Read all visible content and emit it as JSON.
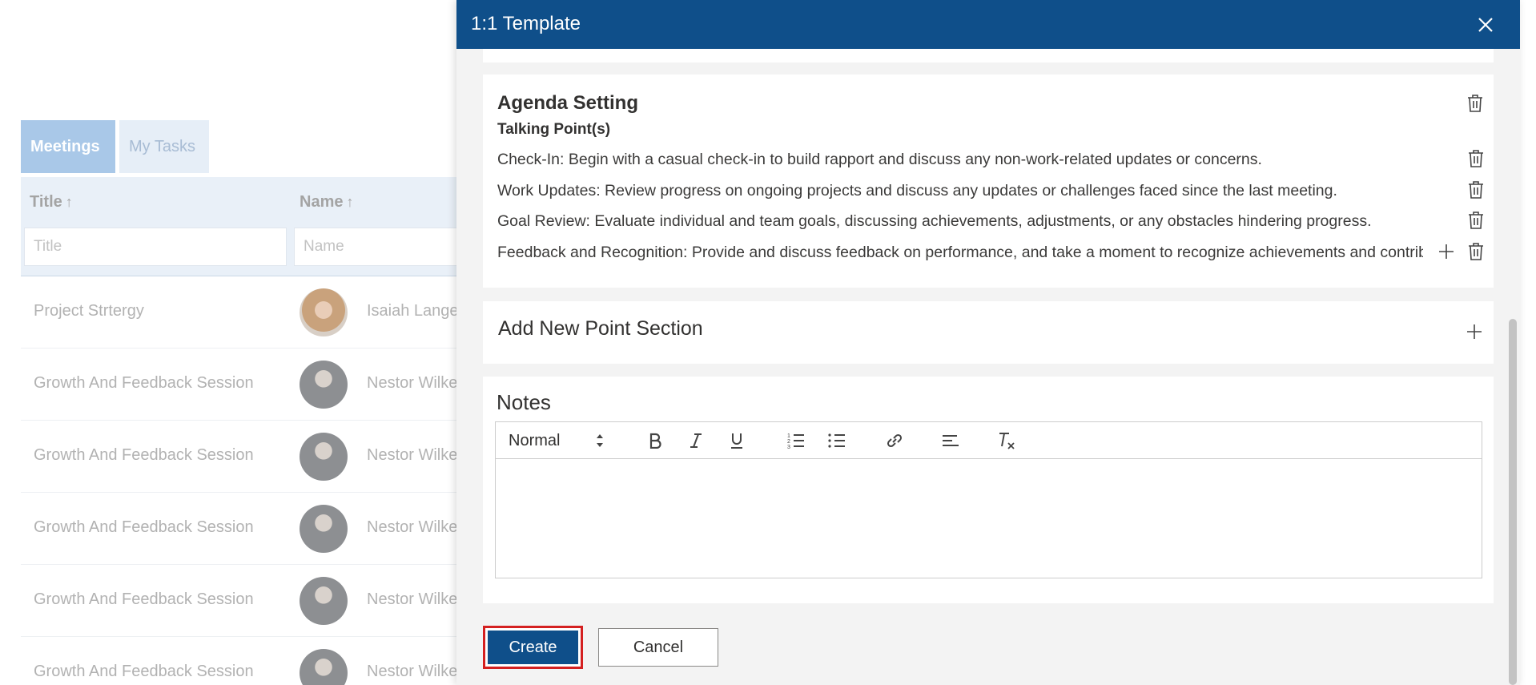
{
  "background": {
    "tabs": [
      {
        "label": "Meetings",
        "active": true
      },
      {
        "label": "My Tasks",
        "active": false
      }
    ],
    "columns": [
      {
        "label": "Title",
        "sort_icon": "arrow-up",
        "filter_placeholder": "Title"
      },
      {
        "label": "Name",
        "sort_icon": "arrow-up",
        "filter_placeholder": "Name"
      }
    ],
    "rows": [
      {
        "title": "Project Strtergy",
        "name": "Isaiah Lange"
      },
      {
        "title": "Growth And Feedback Session",
        "name": "Nestor Wilke"
      },
      {
        "title": "Growth And Feedback Session",
        "name": "Nestor Wilke"
      },
      {
        "title": "Growth And Feedback Session",
        "name": "Nestor Wilke"
      },
      {
        "title": "Growth And Feedback Session",
        "name": "Nestor Wilke"
      },
      {
        "title": "Growth And Feedback Session",
        "name": "Nestor Wilke"
      }
    ]
  },
  "panel": {
    "title": "1:1 Template",
    "close_icon": "close-icon",
    "agenda": {
      "title": "Agenda Setting",
      "subheading": "Talking Point(s)",
      "points": [
        "Check-In:  Begin with a casual check-in to build rapport and discuss any non-work-related updates or concerns.",
        "Work Updates:  Review progress on ongoing projects and discuss any updates or challenges faced since the last meeting.",
        "Goal Review:  Evaluate individual and team goals, discussing achievements, adjustments, or any obstacles hindering progress.",
        "Feedback and Recognition:  Provide and discuss feedback on performance, and take a moment to recognize achievements and contributions."
      ]
    },
    "add_section": {
      "title": "Add New Point Section"
    },
    "notes": {
      "title": "Notes",
      "format_select": "Normal",
      "toolbar_icons": [
        "bold-icon",
        "italic-icon",
        "underline-icon",
        "ordered-list-icon",
        "bullet-list-icon",
        "link-icon",
        "align-icon",
        "clear-format-icon"
      ],
      "editor_value": ""
    },
    "buttons": {
      "create": "Create",
      "cancel": "Cancel"
    },
    "colors": {
      "header": "#0f4f8a",
      "primary_button": "#0f4f8a",
      "focus_outline": "#d42020"
    }
  }
}
